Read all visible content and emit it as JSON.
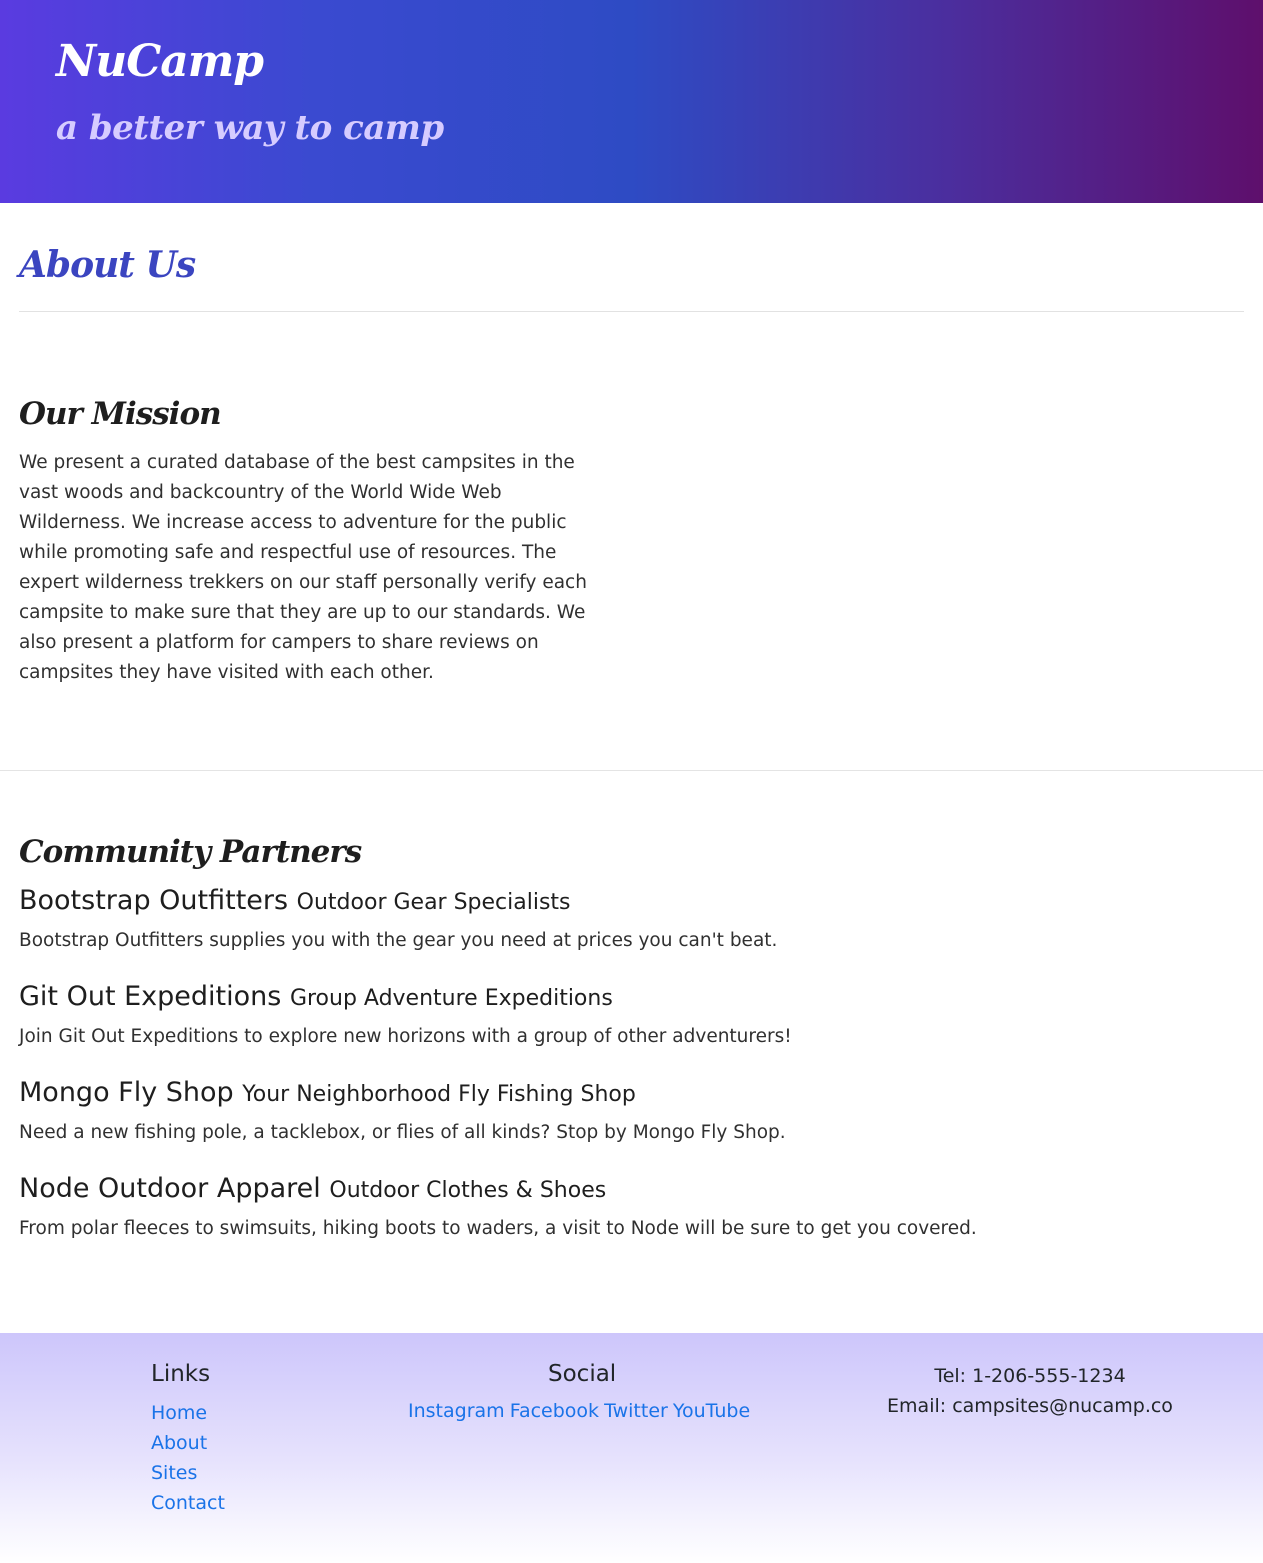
{
  "header": {
    "brand": "NuCamp",
    "tagline": "a better way to camp"
  },
  "page": {
    "title": "About Us"
  },
  "mission": {
    "heading": "Our Mission",
    "text": "We present a curated database of the best campsites in the vast woods and backcountry of the World Wide Web Wilderness. We increase access to adventure for the public while promoting safe and respectful use of resources. The expert wilderness trekkers on our staff personally verify each campsite to make sure that they are up to our standards. We also present a platform for campers to share reviews on campsites they have visited with each other."
  },
  "partners": {
    "heading": "Community Partners",
    "items": [
      {
        "name": "Bootstrap Outfitters",
        "subtitle": "Outdoor Gear Specialists",
        "description": "Bootstrap Outfitters supplies you with the gear you need at prices you can't beat."
      },
      {
        "name": "Git Out Expeditions",
        "subtitle": "Group Adventure Expeditions",
        "description": "Join Git Out Expeditions to explore new horizons with a group of other adventurers!"
      },
      {
        "name": "Mongo Fly Shop",
        "subtitle": "Your Neighborhood Fly Fishing Shop",
        "description": "Need a new fishing pole, a tacklebox, or flies of all kinds? Stop by Mongo Fly Shop."
      },
      {
        "name": "Node Outdoor Apparel",
        "subtitle": "Outdoor Clothes & Shoes",
        "description": "From polar fleeces to swimsuits, hiking boots to waders, a visit to Node will be sure to get you covered."
      }
    ]
  },
  "footer": {
    "links": {
      "title": "Links",
      "items": [
        "Home",
        "About",
        "Sites",
        "Contact"
      ]
    },
    "social": {
      "title": "Social",
      "items": [
        "Instagram",
        "Facebook",
        "Twitter",
        "YouTube"
      ]
    },
    "contact": {
      "tel": "Tel: 1-206-555-1234",
      "email": "Email: campsites@nucamp.co"
    }
  },
  "colors": {
    "header_gradient": [
      "#5a3be0",
      "#2e4bc4",
      "#5e0f6c"
    ],
    "title_accent": "#3b45c0",
    "link": "#1a73e8",
    "footer_bg": "#cdc6fb"
  }
}
